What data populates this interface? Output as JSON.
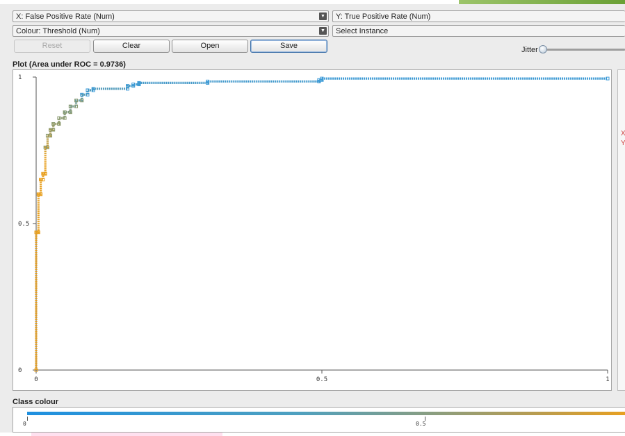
{
  "controls": {
    "x_axis": "X: False Positive Rate (Num)",
    "y_axis": "Y: True Positive Rate (Num)",
    "colour": "Colour: Threshold (Num)",
    "instance": "Select Instance",
    "arrow_icon": "dropdown-arrow-icon"
  },
  "buttons": {
    "reset": "Reset",
    "clear": "Clear",
    "open": "Open",
    "save": "Save"
  },
  "jitter": {
    "label": "Jitter",
    "value": 0
  },
  "plot": {
    "title": "Plot (Area under ROC = 0.9736)"
  },
  "side": {
    "x_mark": "X",
    "y_mark": "Y"
  },
  "class_colour": {
    "title": "Class colour",
    "tick_labels": [
      "0",
      "0.5"
    ],
    "colors": [
      "#1e90e0",
      "#4ea0c0",
      "#b89c50",
      "#e8a020"
    ]
  },
  "chart_data": {
    "type": "line",
    "title": "Plot (Area under ROC = 0.9736)",
    "xlabel": "False Positive Rate",
    "ylabel": "True Positive Rate",
    "xlim": [
      0,
      1
    ],
    "ylim": [
      0,
      1
    ],
    "x_ticks": [
      "0",
      "0.5",
      "1"
    ],
    "y_ticks": [
      "0",
      "0.5",
      "1"
    ],
    "grid": false,
    "series": [
      {
        "x": [
          0,
          0,
          0.004,
          0.004,
          0.008,
          0.008,
          0.012,
          0.012,
          0.016,
          0.016,
          0.02,
          0.02,
          0.025,
          0.025,
          0.03,
          0.03,
          0.04,
          0.04,
          0.05,
          0.05,
          0.06,
          0.06,
          0.07,
          0.07,
          0.08,
          0.08,
          0.09,
          0.09,
          0.1,
          0.1,
          0.16,
          0.16,
          0.17,
          0.17,
          0.18,
          0.18,
          0.3,
          0.3,
          0.495,
          0.495,
          0.5,
          0.5,
          1.0
        ],
        "y": [
          0,
          0.47,
          0.47,
          0.6,
          0.6,
          0.65,
          0.65,
          0.67,
          0.67,
          0.76,
          0.76,
          0.8,
          0.8,
          0.82,
          0.82,
          0.84,
          0.84,
          0.86,
          0.86,
          0.88,
          0.88,
          0.9,
          0.9,
          0.92,
          0.92,
          0.94,
          0.94,
          0.955,
          0.955,
          0.96,
          0.96,
          0.97,
          0.97,
          0.975,
          0.975,
          0.98,
          0.98,
          0.985,
          0.985,
          0.99,
          0.99,
          0.995,
          0.995
        ],
        "threshold_colors": [
          "#e8a020",
          "#8a9a70",
          "#3a9ad8"
        ]
      }
    ]
  }
}
